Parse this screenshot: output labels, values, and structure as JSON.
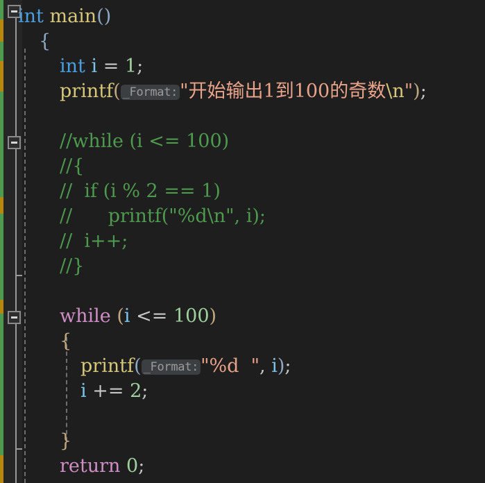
{
  "editor": {
    "background": "#1e1e1e",
    "gutter_background": "#262626",
    "language": "C",
    "font_size_px": 27,
    "line_height_px": 36
  },
  "gutter": {
    "fold_markers": [
      {
        "name": "fold-marker-main",
        "state": "expanded",
        "glyph": "minus"
      },
      {
        "name": "fold-marker-comment-block",
        "state": "expanded",
        "glyph": "minus"
      },
      {
        "name": "fold-marker-while-block",
        "state": "expanded",
        "glyph": "minus"
      }
    ],
    "change_bar_colors": {
      "added": "#4e9a4e",
      "modified": "#b8860b"
    }
  },
  "lines": [
    {
      "n": 1,
      "indent": 0,
      "tokens": [
        {
          "t": "int",
          "c": "type"
        },
        {
          "t": " ",
          "c": "op"
        },
        {
          "t": "main",
          "c": "fn"
        },
        {
          "t": "(",
          "c": "br0"
        },
        {
          "t": ")",
          "c": "br0"
        }
      ]
    },
    {
      "n": 2,
      "indent": 1,
      "tokens": [
        {
          "t": "{",
          "c": "br0"
        }
      ]
    },
    {
      "n": 3,
      "indent": 2,
      "tokens": [
        {
          "t": "int",
          "c": "type"
        },
        {
          "t": " ",
          "c": "op"
        },
        {
          "t": "i",
          "c": "var"
        },
        {
          "t": " = ",
          "c": "op"
        },
        {
          "t": "1",
          "c": "num"
        },
        {
          "t": ";",
          "c": "op"
        }
      ]
    },
    {
      "n": 4,
      "indent": 2,
      "tokens": [
        {
          "t": "printf",
          "c": "fn"
        },
        {
          "t": "(",
          "c": "br1"
        },
        {
          "t": "_Format:",
          "c": "hint"
        },
        {
          "t": "\"开始输出1到100的奇数",
          "c": "str"
        },
        {
          "t": "\\n",
          "c": "esc"
        },
        {
          "t": "\"",
          "c": "str"
        },
        {
          "t": ")",
          "c": "br1"
        },
        {
          "t": ";",
          "c": "op"
        }
      ]
    },
    {
      "n": 5,
      "indent": 0,
      "tokens": []
    },
    {
      "n": 6,
      "indent": 2,
      "tokens": [
        {
          "t": "//while (i <= 100)",
          "c": "cmt"
        }
      ]
    },
    {
      "n": 7,
      "indent": 2,
      "tokens": [
        {
          "t": "//{",
          "c": "cmt"
        }
      ]
    },
    {
      "n": 8,
      "indent": 2,
      "tokens": [
        {
          "t": "//  if (i % 2 == 1)",
          "c": "cmt"
        }
      ]
    },
    {
      "n": 9,
      "indent": 2,
      "tokens": [
        {
          "t": "//      printf(\"%d\\n\", i);",
          "c": "cmt"
        }
      ]
    },
    {
      "n": 10,
      "indent": 2,
      "tokens": [
        {
          "t": "//  i++;",
          "c": "cmt"
        }
      ]
    },
    {
      "n": 11,
      "indent": 2,
      "tokens": [
        {
          "t": "//}",
          "c": "cmt"
        }
      ]
    },
    {
      "n": 12,
      "indent": 0,
      "tokens": []
    },
    {
      "n": 13,
      "indent": 2,
      "tokens": [
        {
          "t": "while",
          "c": "kw"
        },
        {
          "t": " ",
          "c": "op"
        },
        {
          "t": "(",
          "c": "br1"
        },
        {
          "t": "i",
          "c": "var"
        },
        {
          "t": " ",
          "c": "op"
        },
        {
          "t": "<=",
          "c": "op"
        },
        {
          "t": " ",
          "c": "op"
        },
        {
          "t": "100",
          "c": "num"
        },
        {
          "t": ")",
          "c": "br1"
        }
      ]
    },
    {
      "n": 14,
      "indent": 2,
      "tokens": [
        {
          "t": "{",
          "c": "br1"
        }
      ]
    },
    {
      "n": 15,
      "indent": 3,
      "tokens": [
        {
          "t": "printf",
          "c": "fn"
        },
        {
          "t": "(",
          "c": "br2"
        },
        {
          "t": "_Format:",
          "c": "hint"
        },
        {
          "t": "\"%d  \"",
          "c": "str"
        },
        {
          "t": ", ",
          "c": "op"
        },
        {
          "t": "i",
          "c": "var"
        },
        {
          "t": ")",
          "c": "br2"
        },
        {
          "t": ";",
          "c": "op"
        }
      ]
    },
    {
      "n": 16,
      "indent": 3,
      "tokens": [
        {
          "t": "i",
          "c": "var"
        },
        {
          "t": " += ",
          "c": "op"
        },
        {
          "t": "2",
          "c": "num"
        },
        {
          "t": ";",
          "c": "op"
        }
      ]
    },
    {
      "n": 17,
      "indent": 0,
      "tokens": []
    },
    {
      "n": 18,
      "indent": 2,
      "tokens": [
        {
          "t": "}",
          "c": "br1"
        }
      ]
    },
    {
      "n": 19,
      "indent": 2,
      "tokens": [
        {
          "t": "return",
          "c": "kw"
        },
        {
          "t": " ",
          "c": "op"
        },
        {
          "t": "0",
          "c": "num"
        },
        {
          "t": ";",
          "c": "op"
        }
      ]
    }
  ]
}
